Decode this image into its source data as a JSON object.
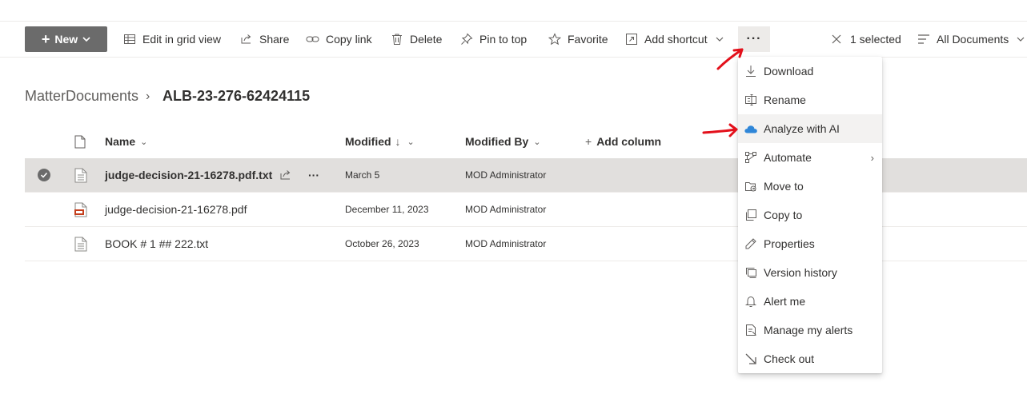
{
  "toolbar": {
    "new_label": "New",
    "edit_grid": "Edit in grid view",
    "share": "Share",
    "copy_link": "Copy link",
    "delete": "Delete",
    "pin_to_top": "Pin to top",
    "favorite": "Favorite",
    "add_shortcut": "Add shortcut",
    "more": "···",
    "selected": "1 selected",
    "view": "All Documents"
  },
  "breadcrumb": {
    "root": "MatterDocuments",
    "separator": "›",
    "current": "ALB-23-276-62424115"
  },
  "columns": {
    "name": "Name",
    "modified": "Modified",
    "modified_sort": "↓",
    "modified_by": "Modified By",
    "add_column": "Add column"
  },
  "files": [
    {
      "name": "judge-decision-21-16278.pdf.txt",
      "modified": "March 5",
      "modified_by": "MOD Administrator",
      "icon": "text-file-icon"
    },
    {
      "name": "judge-decision-21-16278.pdf",
      "modified": "December 11, 2023",
      "modified_by": "MOD Administrator",
      "icon": "pdf-file-icon"
    },
    {
      "name": "BOOK # 1 ## 222.txt",
      "modified": "October 26, 2023",
      "modified_by": "MOD Administrator",
      "icon": "text-file-icon"
    }
  ],
  "menu": {
    "items": [
      {
        "label": "Download",
        "icon": "download-icon"
      },
      {
        "label": "Rename",
        "icon": "rename-icon"
      },
      {
        "label": "Analyze with AI",
        "icon": "cloud-ai-icon"
      },
      {
        "label": "Automate",
        "icon": "automate-icon"
      },
      {
        "label": "Move to",
        "icon": "move-to-icon"
      },
      {
        "label": "Copy to",
        "icon": "copy-to-icon"
      },
      {
        "label": "Properties",
        "icon": "pencil-icon"
      },
      {
        "label": "Version history",
        "icon": "version-history-icon"
      },
      {
        "label": "Alert me",
        "icon": "bell-icon"
      },
      {
        "label": "Manage my alerts",
        "icon": "manage-alerts-icon"
      },
      {
        "label": "Check out",
        "icon": "check-out-icon"
      }
    ],
    "submenu_chevron": "›"
  },
  "colors": {
    "accent": "#0078d4",
    "new_button": "#6b6b6b",
    "selected_row": "#e1dfdd",
    "annotation": "#e3101b"
  }
}
